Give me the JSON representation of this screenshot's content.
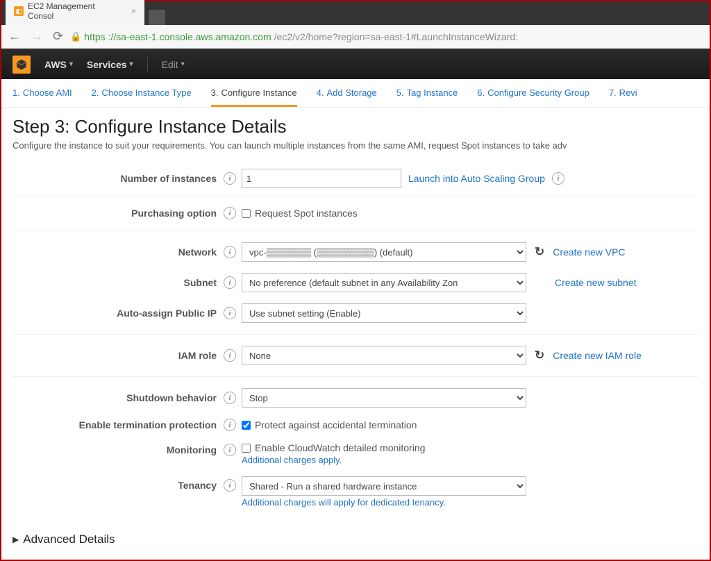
{
  "browser": {
    "tab_title": "EC2 Management Consol",
    "url_scheme": "https",
    "url_host": "://sa-east-1.console.aws.amazon.com",
    "url_path": "/ec2/v2/home?region=sa-east-1#LaunchInstanceWizard:"
  },
  "topnav": {
    "aws": "AWS",
    "services": "Services",
    "edit": "Edit"
  },
  "wizard": {
    "steps": [
      {
        "num": "1.",
        "label": "Choose AMI"
      },
      {
        "num": "2.",
        "label": "Choose Instance Type"
      },
      {
        "num": "3.",
        "label": "Configure Instance"
      },
      {
        "num": "4.",
        "label": "Add Storage"
      },
      {
        "num": "5.",
        "label": "Tag Instance"
      },
      {
        "num": "6.",
        "label": "Configure Security Group"
      },
      {
        "num": "7.",
        "label": "Revi"
      }
    ]
  },
  "page": {
    "title": "Step 3: Configure Instance Details",
    "subtitle": "Configure the instance to suit your requirements. You can launch multiple instances from the same AMI, request Spot instances to take adv"
  },
  "form": {
    "num_instances_label": "Number of instances",
    "num_instances_value": "1",
    "launch_asg": "Launch into Auto Scaling Group",
    "purchasing_label": "Purchasing option",
    "purchasing_checkbox": "Request Spot instances",
    "network_label": "Network",
    "network_value": "vpc-▒▒▒▒▒▒▒ (▒▒▒▒▒▒▒▒▒) (default)",
    "create_vpc": "Create new VPC",
    "subnet_label": "Subnet",
    "subnet_value": "No preference (default subnet in any Availability Zon",
    "create_subnet": "Create new subnet",
    "publicip_label": "Auto-assign Public IP",
    "publicip_value": "Use subnet setting (Enable)",
    "iam_label": "IAM role",
    "iam_value": "None",
    "create_iam": "Create new IAM role",
    "shutdown_label": "Shutdown behavior",
    "shutdown_value": "Stop",
    "termprot_label": "Enable termination protection",
    "termprot_checkbox": "Protect against accidental termination",
    "monitoring_label": "Monitoring",
    "monitoring_checkbox": "Enable CloudWatch detailed monitoring",
    "monitoring_note": "Additional charges apply.",
    "tenancy_label": "Tenancy",
    "tenancy_value": "Shared - Run a shared hardware instance",
    "tenancy_note": "Additional charges will apply for dedicated tenancy."
  },
  "advanced": "Advanced Details"
}
